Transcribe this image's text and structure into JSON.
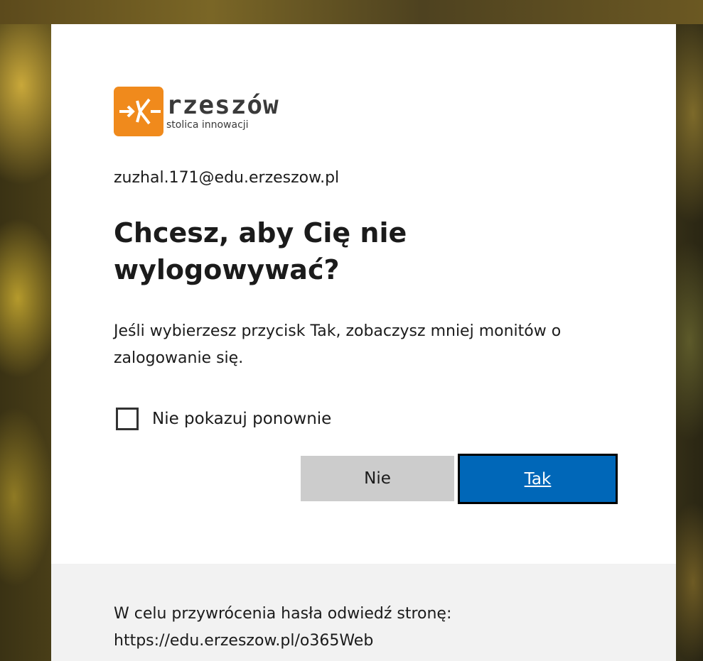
{
  "brand": {
    "name": "rzeszów",
    "tagline": "stolica innowacji",
    "logo_color": "#f08a1c"
  },
  "account": {
    "email": "zuzhal.171@edu.erzeszow.pl"
  },
  "prompt": {
    "title": "Chcesz, aby Cię nie wylogowywać?",
    "description": "Jeśli wybierzesz przycisk Tak, zobaczysz mniej monitów o zalogowanie się.",
    "checkbox_label": "Nie pokazuj ponownie",
    "checkbox_checked": false
  },
  "buttons": {
    "no_label": "Nie",
    "yes_label": "Tak",
    "primary_color": "#0067b8"
  },
  "footer": {
    "line1": "W celu przywrócenia hasła odwiedź stronę:",
    "line2": "https://edu.erzeszow.pl/o365Web"
  }
}
